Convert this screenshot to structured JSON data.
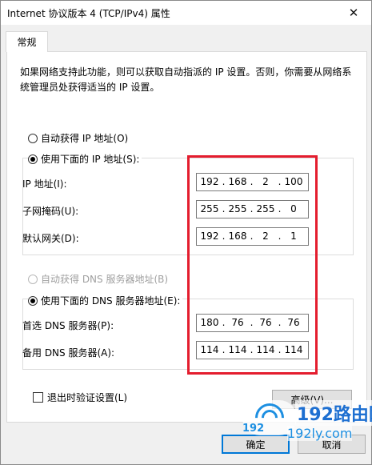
{
  "window": {
    "title": "Internet 协议版本 4 (TCP/IPv4) 属性",
    "close_glyph": "✕"
  },
  "tab": {
    "label": "常规"
  },
  "description": "如果网络支持此功能，则可以获取自动指派的 IP 设置。否则，你需要从网络系统管理员处获得适当的 IP 设置。",
  "ip_mode": {
    "auto_label": "自动获得 IP 地址(O)",
    "manual_label": "使用下面的 IP 地址(S):",
    "selected": "manual"
  },
  "ip_fields": [
    {
      "label": "IP 地址(I):",
      "octets": [
        "192",
        "168",
        "2",
        "100"
      ]
    },
    {
      "label": "子网掩码(U):",
      "octets": [
        "255",
        "255",
        "255",
        "0"
      ]
    },
    {
      "label": "默认网关(D):",
      "octets": [
        "192",
        "168",
        "2",
        "1"
      ]
    }
  ],
  "dns_mode": {
    "auto_label": "自动获得 DNS 服务器地址(B)",
    "manual_label": "使用下面的 DNS 服务器地址(E):",
    "selected": "manual",
    "auto_disabled": true
  },
  "dns_fields": [
    {
      "label": "首选 DNS 服务器(P):",
      "octets": [
        "180",
        "76",
        "76",
        "76"
      ]
    },
    {
      "label": "备用 DNS 服务器(A):",
      "octets": [
        "114",
        "114",
        "114",
        "114"
      ]
    }
  ],
  "validate_checkbox": {
    "label": "退出时验证设置(L)",
    "checked": false
  },
  "buttons": {
    "advanced": "高级(V)...",
    "ok": "确定",
    "cancel": "取消"
  },
  "watermark": {
    "brand": "192路由网",
    "url": "192ly.com",
    "prefix": "192"
  },
  "colors": {
    "highlight": "#e41d2e",
    "accent": "#0078d7",
    "watermark": "#1d8fe1"
  }
}
